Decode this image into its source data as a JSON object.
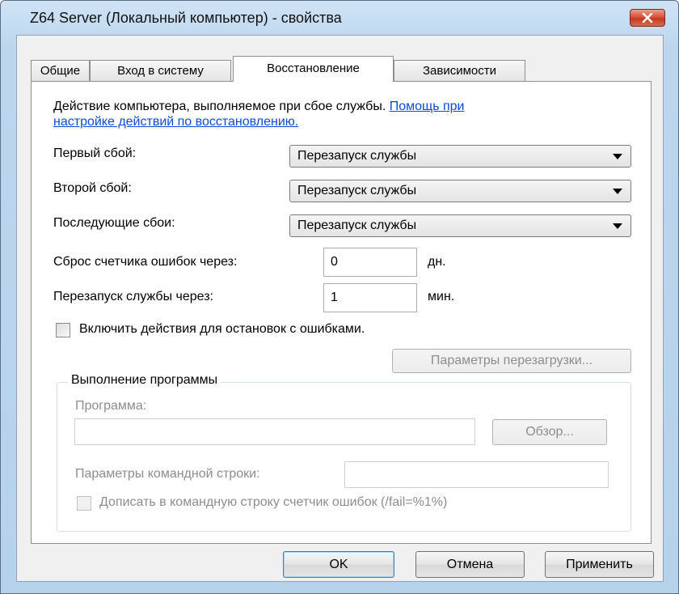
{
  "window": {
    "title": "Z64 Server (Локальный компьютер) - свойства"
  },
  "tabs": [
    {
      "label": "Общие"
    },
    {
      "label": "Вход в систему"
    },
    {
      "label": "Восстановление"
    },
    {
      "label": "Зависимости"
    }
  ],
  "recovery": {
    "description": "Действие компьютера, выполняемое при сбое службы.",
    "help_link_line1": "Помощь при",
    "help_link_line2": "настройке действий по восстановлению.",
    "first_failure_label": "Первый сбой:",
    "first_failure_value": "Перезапуск службы",
    "second_failure_label": "Второй сбой:",
    "second_failure_value": "Перезапуск службы",
    "subsequent_failures_label": "Последующие сбои:",
    "subsequent_failures_value": "Перезапуск службы",
    "reset_count_label": "Сброс счетчика ошибок через:",
    "reset_count_value": "0",
    "reset_count_unit": "дн.",
    "restart_after_label": "Перезапуск службы через:",
    "restart_after_value": "1",
    "restart_after_unit": "мин.",
    "enable_actions_label": "Включить действия для остановок с ошибками.",
    "restart_options_button": "Параметры перезагрузки..."
  },
  "run_program": {
    "group_title": "Выполнение программы",
    "program_label": "Программа:",
    "program_value": "",
    "browse_button": "Обзор...",
    "cmd_params_label": "Параметры командной строки:",
    "cmd_params_value": "",
    "append_fail_label": "Дописать в командную строку счетчик ошибок (/fail=%1%)"
  },
  "footer": {
    "ok_button": "OK",
    "cancel_button": "Отмена",
    "apply_button": "Применить"
  }
}
